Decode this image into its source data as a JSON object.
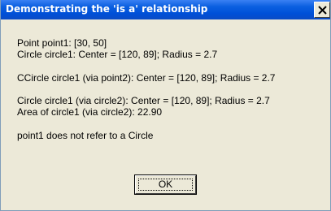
{
  "window": {
    "title": "Demonstrating the 'is a' relationship"
  },
  "message": {
    "lines": [
      "Point point1: [30, 50]",
      "Circle circle1: Center = [120, 89]; Radius = 2.7",
      "CCircle circle1 (via point2): Center = [120, 89]; Radius = 2.7",
      "Circle circle1 (via circle2): Center = [120, 89]; Radius = 2.7",
      "Area of circle1 (via circle2): 22.90",
      "point1 does not refer to a Circle"
    ]
  },
  "buttons": {
    "ok_label": "OK"
  },
  "colors": {
    "titlebar": "#0a5fe0",
    "dialog_bg": "#ece9d8"
  },
  "icons": {
    "close": "close-icon"
  }
}
